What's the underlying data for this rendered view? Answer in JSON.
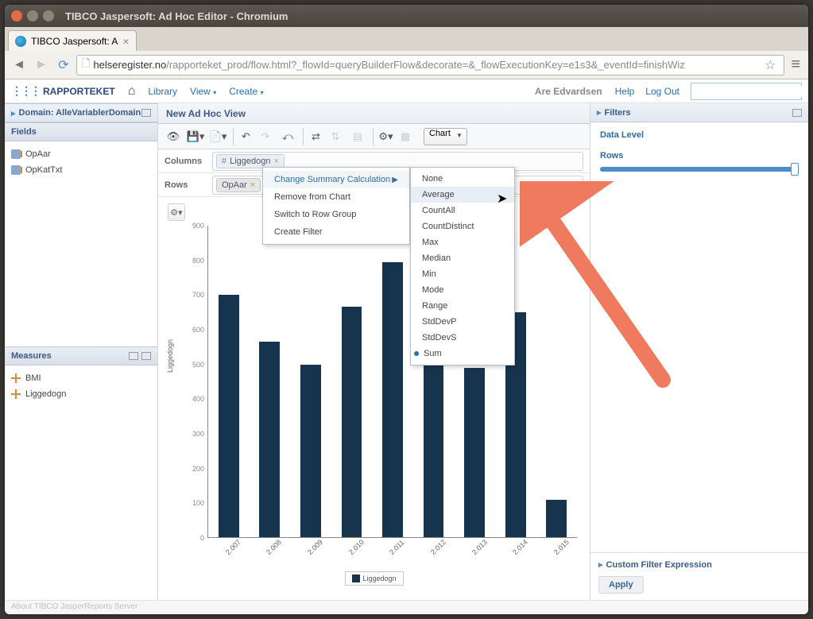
{
  "window_title": "TIBCO Jaspersoft: Ad Hoc Editor - Chromium",
  "tab": {
    "title": "TIBCO Jaspersoft: A"
  },
  "url": {
    "host": "helseregister.no",
    "path": "/rapporteket_prod/flow.html?_flowId=queryBuilderFlow&decorate=&_flowExecutionKey=e1s3&_eventId=finishWiz"
  },
  "brand": "RAPPORTEKET",
  "topmenu": {
    "library": "Library",
    "view": "View",
    "create": "Create"
  },
  "user": "Are Edvardsen",
  "toplinks": {
    "help": "Help",
    "logout": "Log Out"
  },
  "left": {
    "domain": "Domain: AlleVariablerDomain",
    "fields_hdr": "Fields",
    "fields": [
      "OpAar",
      "OpKatTxt"
    ],
    "measures_hdr": "Measures",
    "measures": [
      "BMI",
      "Liggedogn"
    ]
  },
  "center": {
    "title": "New Ad Hoc View",
    "viewtype": "Chart",
    "columns_lbl": "Columns",
    "rows_lbl": "Rows",
    "col_pill": "Liggedogn",
    "row_pill": "OpAar"
  },
  "ctx1": {
    "change": "Change Summary Calculation",
    "remove": "Remove from Chart",
    "switch": "Switch to Row Group",
    "filter": "Create Filter"
  },
  "ctx2": [
    "None",
    "Average",
    "CountAll",
    "CountDistinct",
    "Max",
    "Median",
    "Min",
    "Mode",
    "Range",
    "StdDevP",
    "StdDevS",
    "Sum"
  ],
  "right": {
    "filters": "Filters",
    "data_level": "Data Level",
    "rows": "Rows",
    "custom": "Custom Filter Expression",
    "apply": "Apply"
  },
  "chart_data": {
    "type": "bar",
    "ylabel": "Liggedogn",
    "ylim": [
      0,
      900
    ],
    "yticks": [
      0,
      100,
      200,
      300,
      400,
      500,
      600,
      700,
      800,
      900
    ],
    "categories": [
      "2.007",
      "2.008",
      "2.009",
      "2.010",
      "2.011",
      "2.012",
      "2.013",
      "2.014",
      "2.015"
    ],
    "values": [
      700,
      565,
      498,
      665,
      795,
      540,
      490,
      650,
      108
    ],
    "legend": "Liggedogn"
  },
  "footer": "About TIBCO JasperReports Server"
}
